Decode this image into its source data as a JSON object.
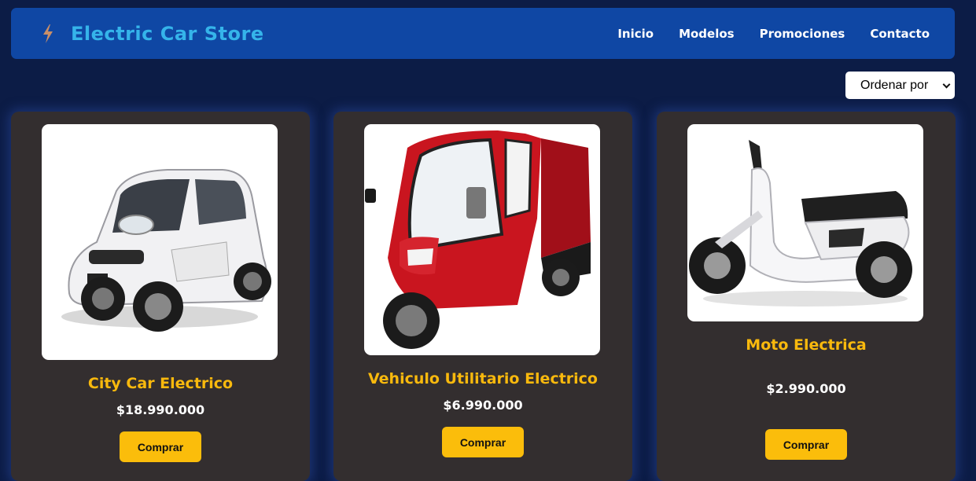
{
  "header": {
    "title": "Electric Car Store",
    "logo_icon": "lightning-bolt-icon",
    "nav": [
      "Inicio",
      "Modelos",
      "Promociones",
      "Contacto"
    ]
  },
  "sort": {
    "label": "Ordenar por"
  },
  "colors": {
    "page_bg": "#0c1c46",
    "navbar_bg": "#0f47a4",
    "brand_title": "#35b4ea",
    "card_bg": "#332e2f",
    "product_title": "#f9b90d",
    "button_bg": "#fbbd0b"
  },
  "products": [
    {
      "name": "City Car Electrico",
      "price": "$18.990.000",
      "button": "Comprar"
    },
    {
      "name": "Vehiculo Utilitario Electrico",
      "price": "$6.990.000",
      "button": "Comprar"
    },
    {
      "name": "Moto Electrica",
      "price": "$2.990.000",
      "button": "Comprar"
    }
  ]
}
